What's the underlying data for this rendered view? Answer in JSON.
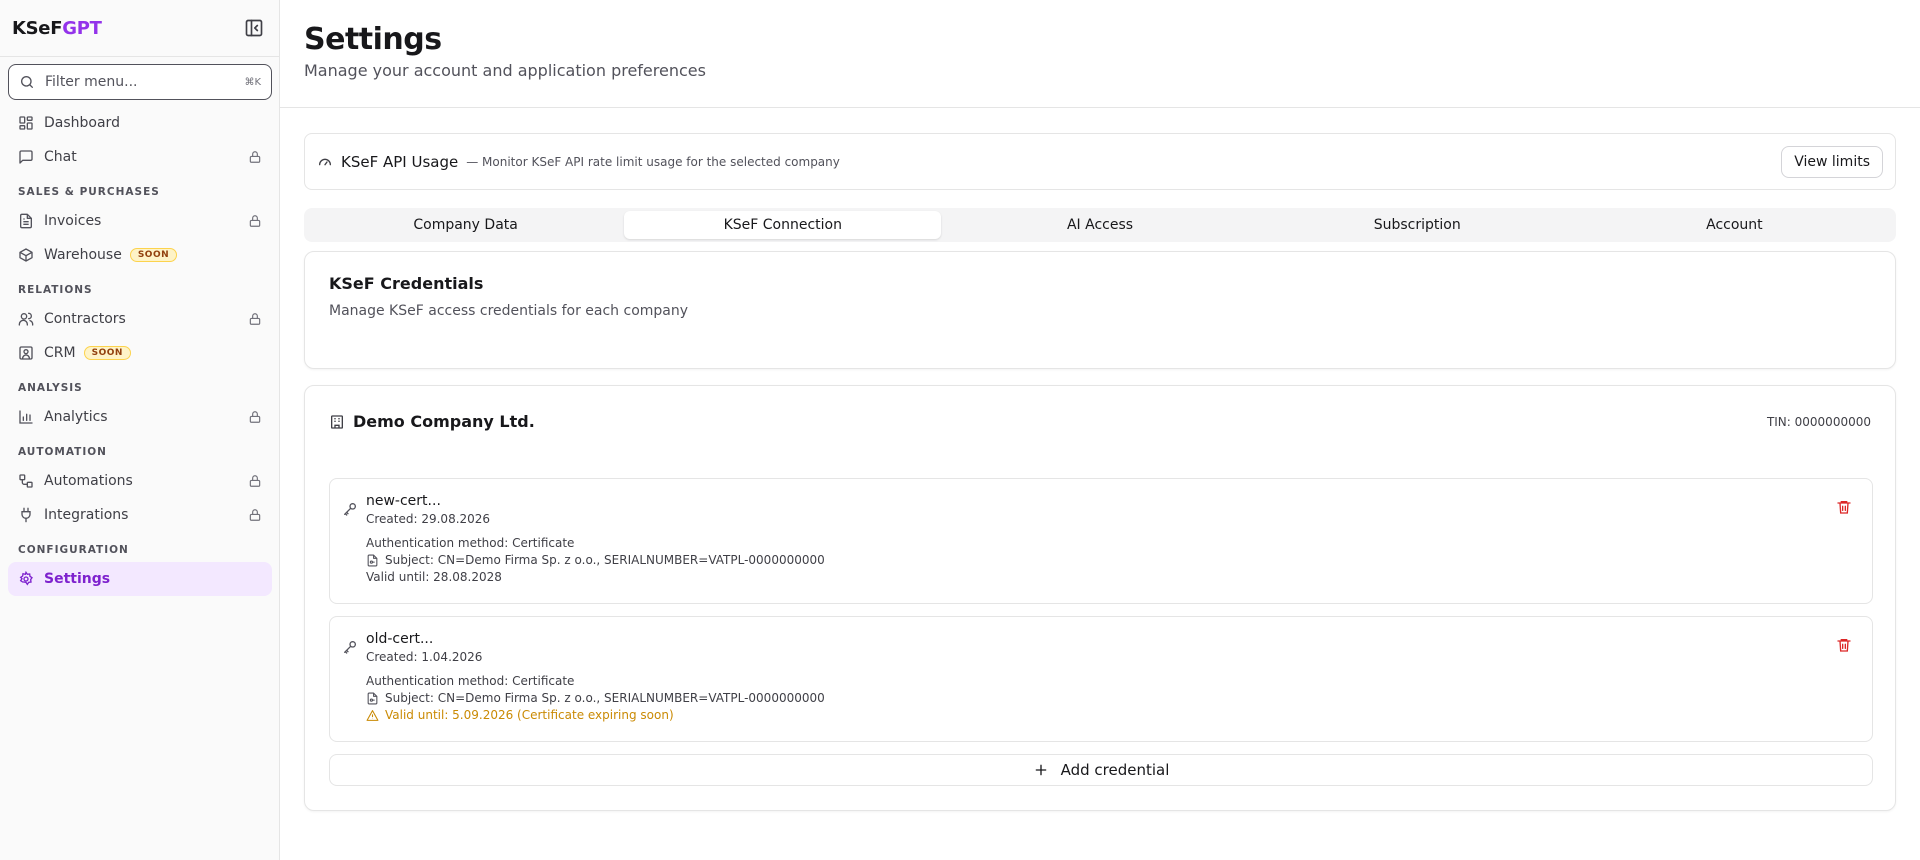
{
  "brand": {
    "prefix": "KSeF",
    "suffix": "GPT"
  },
  "filter": {
    "placeholder": "Filter menu...",
    "shortcut": "⌘K"
  },
  "nav": {
    "dashboard": "Dashboard",
    "chat": "Chat",
    "sections": {
      "sales": "SALES & PURCHASES",
      "relations": "RELATIONS",
      "analysis": "ANALYSIS",
      "automation": "AUTOMATION",
      "configuration": "CONFIGURATION"
    },
    "invoices": "Invoices",
    "warehouse": "Warehouse",
    "contractors": "Contractors",
    "crm": "CRM",
    "analytics": "Analytics",
    "automations": "Automations",
    "integrations": "Integrations",
    "settings": "Settings",
    "soon_badge": "SOON"
  },
  "page": {
    "title": "Settings",
    "subtitle": "Manage your account and application preferences"
  },
  "usage": {
    "title": "KSeF API Usage",
    "description": "— Monitor KSeF API rate limit usage for the selected company",
    "button": "View limits"
  },
  "tabs": [
    "Company Data",
    "KSeF Connection",
    "AI Access",
    "Subscription",
    "Account"
  ],
  "active_tab": "KSeF Connection",
  "credentials": {
    "title": "KSeF Credentials",
    "description": "Manage KSeF access credentials for each company"
  },
  "company": {
    "name": "Demo Company Ltd.",
    "tin": "TIN: 0000000000",
    "certs": [
      {
        "name": "new-cert...",
        "created": "Created: 29.08.2026",
        "auth": "Authentication method:  Certificate",
        "subject": "Subject: CN=Demo Firma Sp. z o.o., SERIALNUMBER=VATPL-0000000000",
        "valid": "Valid until: 28.08.2028"
      },
      {
        "name": "old-cert...",
        "created": "Created: 1.04.2026",
        "auth": "Authentication method:  Certificate",
        "subject": "Subject: CN=Demo Firma Sp. z o.o., SERIALNUMBER=VATPL-0000000000",
        "valid": "Valid until: 5.09.2026 (Certificate expiring soon)"
      }
    ],
    "add_label": "Add credential"
  },
  "colors": {
    "accent": "#9333ea",
    "active_bg": "#f3e8ff",
    "warning": "#ca8a04",
    "danger": "#dc2626"
  }
}
